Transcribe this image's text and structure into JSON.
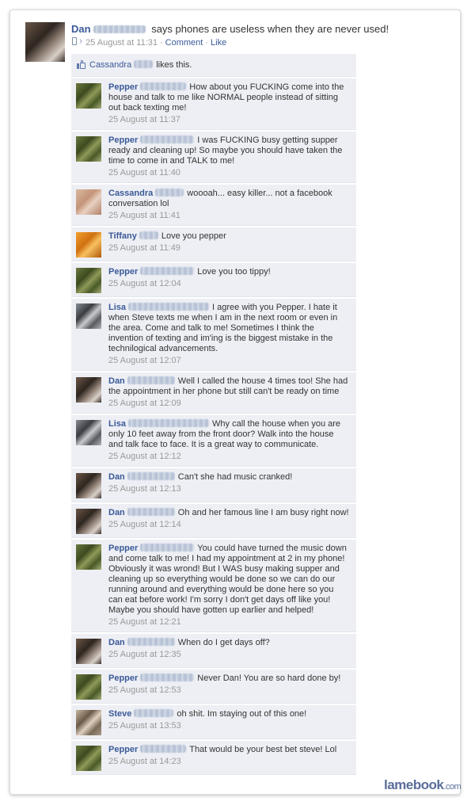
{
  "post": {
    "author": "Dan",
    "status": "says phones are useless when they are never used!",
    "time": "25 August at 11:31",
    "comment_label": "Comment",
    "like_label": "Like"
  },
  "likes": {
    "name": "Cassandra",
    "text": "likes this."
  },
  "comments": [
    {
      "author": "Pepper",
      "text": "How about you FUCKING come into the house and talk to me like NORMAL people instead of sitting out back texting me!",
      "time": "25 August at 11:37"
    },
    {
      "author": "Pepper",
      "text": "I was FUCKING busy getting supper ready and cleaning up! So maybe you should have taken the time to come in and TALK to me!",
      "time": "25 August at 11:40"
    },
    {
      "author": "Cassandra",
      "text": "woooah... easy killer... not a facebook conversation lol",
      "time": "25 August at 11:41"
    },
    {
      "author": "Tiffany",
      "text": "Love you pepper",
      "time": "25 August at 11:49"
    },
    {
      "author": "Pepper",
      "text": "Love you too tippy!",
      "time": "25 August at 12:04"
    },
    {
      "author": "Lisa",
      "text": "I agree with you Pepper. I hate it when Steve texts me when I am in the next room or even in the area. Come and talk to me! Sometimes I think the invention of texting and im'ing is the biggest mistake in the technilogical advancements.",
      "time": "25 August at 12:07"
    },
    {
      "author": "Dan",
      "text": "Well I called the house 4 times too! She had the appointment in her phone but still can't be ready on time",
      "time": "25 August at 12:09"
    },
    {
      "author": "Lisa",
      "text": "Why call the house when you are only 10 feet away from the front door? Walk into the house and talk face to face. It is a great way to communicate.",
      "time": "25 August at 12:12"
    },
    {
      "author": "Dan",
      "text": "Can't she had music cranked!",
      "time": "25 August at 12:13"
    },
    {
      "author": "Dan",
      "text": "Oh and her famous line I am busy right now!",
      "time": "25 August at 12:14"
    },
    {
      "author": "Pepper",
      "text": "You could have turned the music down and come talk to me! I had my appointment at 2 in my phone! Obviously it was wrond! But I WAS busy making supper and cleaning up so everything would be done so we can do our running around and everything would be done here so you can eat before work! I'm sorry I don't get days off like you! Maybe you should have gotten up earlier and helped!",
      "time": "25 August at 12:21"
    },
    {
      "author": "Dan",
      "text": "When do I get days off?",
      "time": "25 August at 12:35"
    },
    {
      "author": "Pepper",
      "text": "Never Dan! You are so hard done by!",
      "time": "25 August at 12:53"
    },
    {
      "author": "Steve",
      "text": "oh shit. Im staying out of this one!",
      "time": "25 August at 13:53"
    },
    {
      "author": "Pepper",
      "text": "That would be your best bet steve! Lol",
      "time": "25 August at 14:23"
    }
  ],
  "watermark": {
    "brand": "lamebook",
    "domain": ".com"
  }
}
